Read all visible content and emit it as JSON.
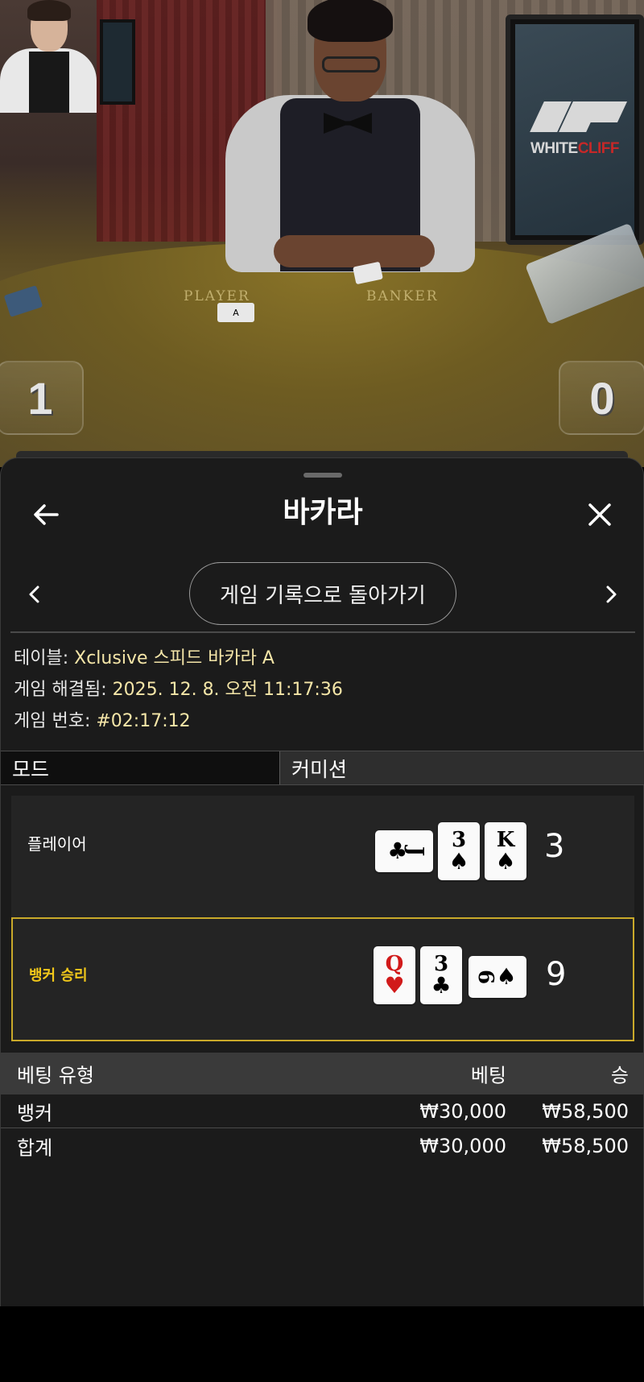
{
  "video": {
    "felt_player": "PLAYER",
    "felt_banker": "BANKER",
    "brand_prefix": "WHITE",
    "brand_suffix": "CLIFF",
    "player_score": "1",
    "banker_score": "0",
    "dealt_card": "A"
  },
  "header": {
    "title": "바카라",
    "back_icon": "arrow-left-icon",
    "close_icon": "close-icon"
  },
  "nav": {
    "return_label": "게임 기록으로 돌아가기",
    "prev_icon": "chevron-left-icon",
    "next_icon": "chevron-right-icon"
  },
  "meta": {
    "table_label": "테이블: ",
    "table_value": "Xclusive 스피드 바카라 A",
    "resolved_label": "게임 해결됨: ",
    "resolved_value": "2025. 12. 8. 오전 11:17:36",
    "round_label": "게임 번호: ",
    "round_value": "#02:17:12"
  },
  "tabs": {
    "mode": "모드",
    "commission": "커미션"
  },
  "hands": {
    "player": {
      "label": "플레이어",
      "total": "3",
      "cards": [
        {
          "rank": "J",
          "suit": "♣",
          "color": "black",
          "sideways": true
        },
        {
          "rank": "3",
          "suit": "♠",
          "color": "black",
          "sideways": false
        },
        {
          "rank": "K",
          "suit": "♠",
          "color": "black",
          "sideways": false
        }
      ]
    },
    "banker": {
      "label": "뱅커 승리",
      "total": "9",
      "cards": [
        {
          "rank": "Q",
          "suit": "♥",
          "color": "red",
          "sideways": false
        },
        {
          "rank": "3",
          "suit": "♣",
          "color": "black",
          "sideways": false
        },
        {
          "rank": "6",
          "suit": "♠",
          "color": "black",
          "sideways": true
        }
      ]
    }
  },
  "bets": {
    "headers": {
      "type": "베팅 유형",
      "bet": "베팅",
      "win": "승"
    },
    "rows": [
      {
        "type": "뱅커",
        "bet": "₩30,000",
        "win": "₩58,500"
      }
    ],
    "total": {
      "type": "합계",
      "bet": "₩30,000",
      "win": "₩58,500"
    }
  },
  "colors": {
    "panel_bg": "#1b1b1b",
    "winner_border": "#c9a92a",
    "winner_label": "#f2c81a",
    "meta_value": "#f5e6a8"
  }
}
